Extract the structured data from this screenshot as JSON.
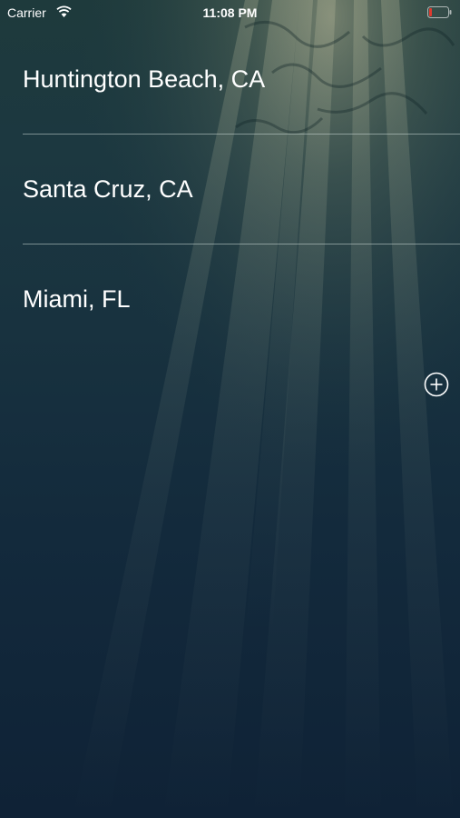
{
  "status_bar": {
    "carrier": "Carrier",
    "time": "11:08 PM",
    "wifi_icon": "wifi-icon",
    "battery_icon": "battery-icon",
    "battery_color": "#e03a2f"
  },
  "cities": [
    {
      "name": "Huntington Beach, CA"
    },
    {
      "name": "Santa Cruz, CA"
    },
    {
      "name": "Miami, FL"
    }
  ],
  "add_button": {
    "icon": "plus-circle-icon"
  },
  "colors": {
    "background_top": "#1e3a3c",
    "background_bottom": "#0f2236",
    "text": "#ffffff",
    "divider": "#c8d7d4"
  }
}
